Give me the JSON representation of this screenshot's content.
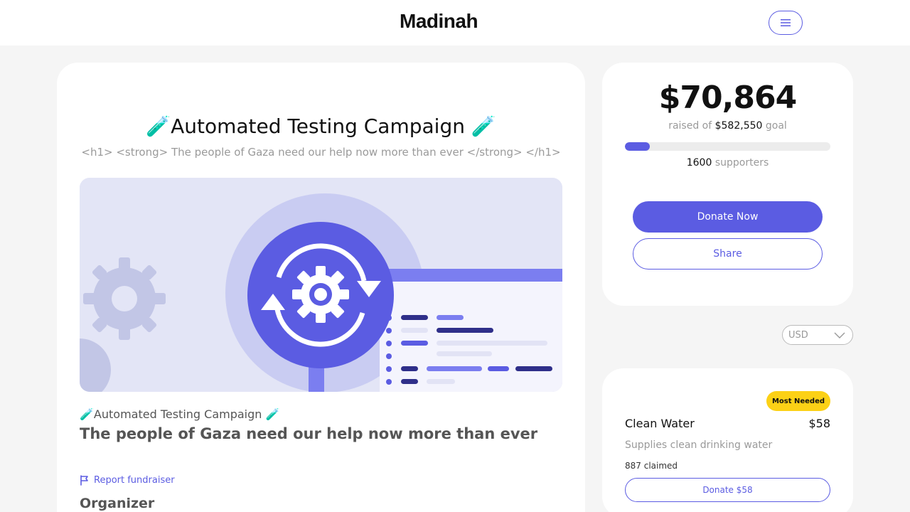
{
  "header": {
    "logo_text": "Madinah",
    "menu_icon": "hamburger-icon"
  },
  "campaign": {
    "title": "🧪Automated Testing Campaign 🧪",
    "subtitle": "<h1> <strong> The people of Gaza need our help now more than ever </strong> </h1>",
    "small_title": "🧪Automated Testing Campaign 🧪",
    "headline": "The people of Gaza need our help now more than ever",
    "report_label": "Report fundraiser",
    "report_icon": "flag-icon",
    "organizer_heading": "Organizer",
    "hero_image_icon": "gear-sync-icon"
  },
  "donation": {
    "raised": "$70,864",
    "raised_of_label": "raised of",
    "goal": "$582,550",
    "goal_label": "goal",
    "progress_fraction": 0.122,
    "supporters_count": "1600",
    "supporters_label": "supporters",
    "donate_label": "Donate Now",
    "share_label": "Share"
  },
  "currency": {
    "selected": "USD"
  },
  "items": [
    {
      "badge": "Most Needed",
      "name": "Clean Water",
      "price": "$58",
      "description": "Supplies clean drinking water",
      "claimed": "887 claimed",
      "button_label": "Donate $58"
    }
  ],
  "colors": {
    "accent": "#5b5ce2",
    "badge": "#fcd116",
    "page_bg": "#f5f5f5"
  }
}
